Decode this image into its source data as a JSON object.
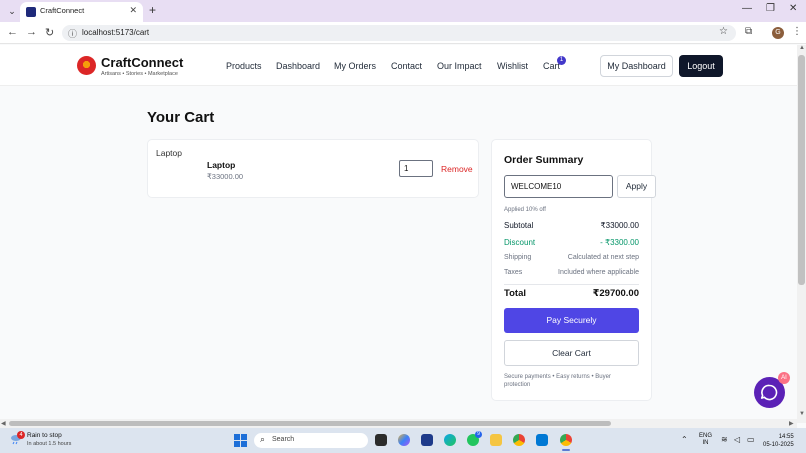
{
  "browser": {
    "tab_title": "CraftConnect",
    "url": "localhost:5173/cart",
    "profile_initial": "G"
  },
  "header": {
    "brand_name": "CraftConnect",
    "brand_tagline": "Artisans • Stories • Marketplace",
    "nav": {
      "products": "Products",
      "dashboard": "Dashboard",
      "orders": "My Orders",
      "contact": "Contact",
      "impact": "Our Impact",
      "wishlist": "Wishlist",
      "cart": "Cart"
    },
    "cart_count": "1",
    "my_dashboard_label": "My Dashboard",
    "logout_label": "Logout"
  },
  "page": {
    "title": "Your Cart"
  },
  "cart": {
    "items": [
      {
        "image_alt": "Laptop",
        "name": "Laptop",
        "price": "₹33000.00",
        "quantity": "1",
        "remove_label": "Remove"
      }
    ]
  },
  "summary": {
    "title": "Order Summary",
    "promo_code": "WELCOME10",
    "apply_label": "Apply",
    "applied_note": "Applied 10% off",
    "subtotal_label": "Subtotal",
    "subtotal_value": "₹33000.00",
    "discount_label": "Discount",
    "discount_value": "- ₹3300.00",
    "shipping_label": "Shipping",
    "shipping_value": "Calculated at next step",
    "taxes_label": "Taxes",
    "taxes_value": "Included where applicable",
    "total_label": "Total",
    "total_value": "₹29700.00",
    "pay_label": "Pay Securely",
    "clear_label": "Clear Cart",
    "footer_note": "Secure payments • Easy returns • Buyer protection"
  },
  "chat": {
    "badge": "AI"
  },
  "taskbar": {
    "weather_badge": "4",
    "weather_title": "Rain to stop",
    "weather_sub": "In about 1.5 hours",
    "search_label": "Search",
    "whatsapp_badge": "9",
    "lang_line1": "ENG",
    "lang_line2": "IN",
    "time": "14:55",
    "date": "05-10-2025"
  },
  "colors": {
    "accent": "#4f46e5",
    "remove": "#dc2626",
    "discount": "#059669",
    "dark_button": "#0f172a"
  }
}
